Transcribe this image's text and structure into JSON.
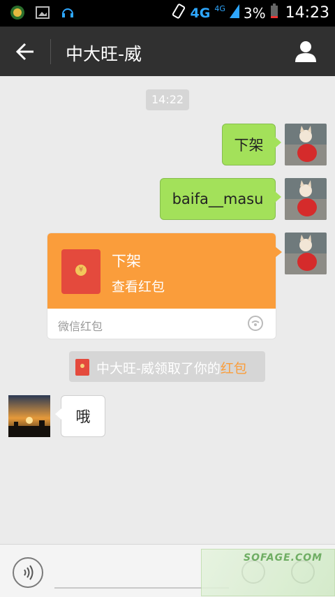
{
  "status_bar": {
    "network": "4G",
    "network_secondary": "4G",
    "battery": "3%",
    "time": "14:23"
  },
  "header": {
    "title": "中大旺-威"
  },
  "chat": {
    "timestamp": "14:22",
    "messages": [
      {
        "side": "right",
        "type": "text",
        "text": "下架"
      },
      {
        "side": "right",
        "type": "text",
        "text": "baifa__masu"
      },
      {
        "side": "right",
        "type": "red_packet",
        "title": "下架",
        "subtitle": "查看红包",
        "label": "微信红包"
      },
      {
        "side": "left",
        "type": "text",
        "text": "哦"
      }
    ],
    "system_notice": {
      "prefix": "中大旺-威领取了你的",
      "link": "红包"
    }
  },
  "colors": {
    "title_bar": "#303030",
    "green_bubble": "#a3e15a",
    "red_packet": "#fa9d3b",
    "background": "#ebebeb"
  },
  "input_bar": {
    "voice_icon": "voice-icon",
    "emoji_icon": "emoji-icon",
    "plus_icon": "plus-icon"
  },
  "watermark": {
    "text": "SOFAGE.COM"
  }
}
